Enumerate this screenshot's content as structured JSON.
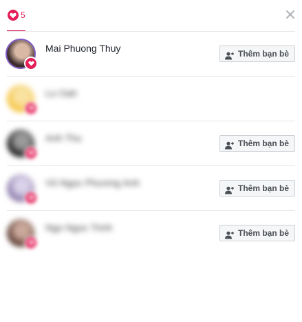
{
  "header": {
    "reaction_count": "5",
    "tab_icon": "heart-icon",
    "close_icon": "close-icon",
    "accent": "#e41e57"
  },
  "people": [
    {
      "name": "Mai Phuong Thuy",
      "blurred": false,
      "show_button": true,
      "avatar_colors": [
        "#3a2a2a",
        "#d9b9a5"
      ]
    },
    {
      "name": "Lo Oah",
      "blurred": true,
      "show_button": false,
      "avatar_colors": [
        "#f6c544",
        "#f9e2a1"
      ]
    },
    {
      "name": "Anh Thu",
      "blurred": true,
      "show_button": true,
      "avatar_colors": [
        "#1a1a1a",
        "#9a9a9a"
      ]
    },
    {
      "name": "Vũ Ngọc Phương Anh",
      "blurred": true,
      "show_button": true,
      "avatar_colors": [
        "#8b7aa8",
        "#d9d2ea"
      ]
    },
    {
      "name": "Ngo Ngoc Trinh",
      "blurred": true,
      "show_button": true,
      "avatar_colors": [
        "#5a3a30",
        "#caa89a"
      ]
    }
  ],
  "add_friend_label": "Thêm bạn bè",
  "add_friend_icon": "add-friend-icon",
  "reaction_badge_icon": "heart-icon"
}
